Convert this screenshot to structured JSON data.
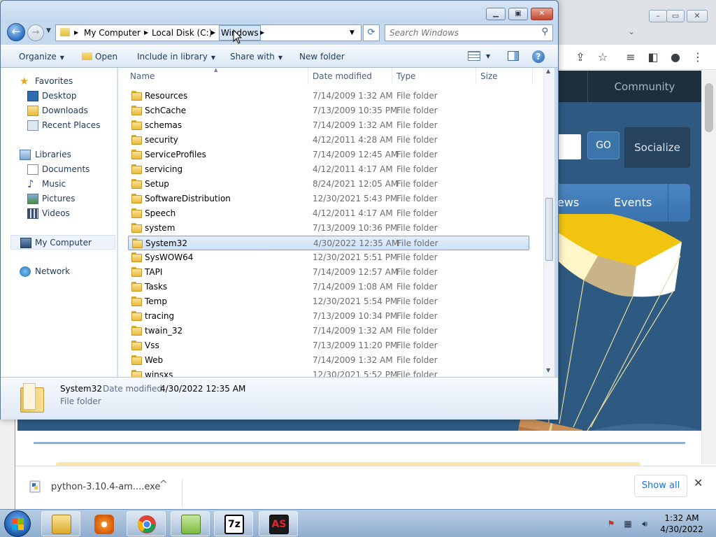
{
  "browser": {
    "site_nav": {
      "community": "Community"
    },
    "hero": {
      "go_button": "GO",
      "socialize": "Socialize",
      "nav_news": "ews",
      "nav_events": "Events"
    },
    "downloads_shelf": {
      "file_name": "python-3.10.4-am....exe",
      "show_all": "Show all"
    }
  },
  "explorer": {
    "address": {
      "crumbs": [
        "My Computer",
        "Local Disk (C:)",
        "Windows"
      ]
    },
    "search": {
      "placeholder": "Search Windows"
    },
    "commands": {
      "organize": "Organize",
      "open": "Open",
      "include_in_library": "Include in library",
      "share_with": "Share with",
      "new_folder": "New folder"
    },
    "nav_pane": {
      "favorites": "Favorites",
      "desktop": "Desktop",
      "downloads": "Downloads",
      "recent_places": "Recent Places",
      "libraries": "Libraries",
      "documents": "Documents",
      "music": "Music",
      "pictures": "Pictures",
      "videos": "Videos",
      "my_computer": "My Computer",
      "network": "Network"
    },
    "columns": {
      "name": "Name",
      "date_modified": "Date modified",
      "type": "Type",
      "size": "Size"
    },
    "files": [
      {
        "name": "Resources",
        "date": "7/14/2009 1:32 AM",
        "type": "File folder"
      },
      {
        "name": "SchCache",
        "date": "7/13/2009 10:35 PM",
        "type": "File folder"
      },
      {
        "name": "schemas",
        "date": "7/14/2009 1:32 AM",
        "type": "File folder"
      },
      {
        "name": "security",
        "date": "4/12/2011 4:28 AM",
        "type": "File folder"
      },
      {
        "name": "ServiceProfiles",
        "date": "7/14/2009 12:45 AM",
        "type": "File folder"
      },
      {
        "name": "servicing",
        "date": "4/12/2011 4:17 AM",
        "type": "File folder"
      },
      {
        "name": "Setup",
        "date": "8/24/2021 12:05 AM",
        "type": "File folder"
      },
      {
        "name": "SoftwareDistribution",
        "date": "12/30/2021 5:43 PM",
        "type": "File folder"
      },
      {
        "name": "Speech",
        "date": "4/12/2011 4:17 AM",
        "type": "File folder"
      },
      {
        "name": "system",
        "date": "7/13/2009 10:36 PM",
        "type": "File folder"
      },
      {
        "name": "System32",
        "date": "4/30/2022 12:35 AM",
        "type": "File folder"
      },
      {
        "name": "SysWOW64",
        "date": "12/30/2021 5:51 PM",
        "type": "File folder"
      },
      {
        "name": "TAPI",
        "date": "7/14/2009 12:57 AM",
        "type": "File folder"
      },
      {
        "name": "Tasks",
        "date": "7/14/2009 1:08 AM",
        "type": "File folder"
      },
      {
        "name": "Temp",
        "date": "12/30/2021 5:54 PM",
        "type": "File folder"
      },
      {
        "name": "tracing",
        "date": "7/13/2009 10:34 PM",
        "type": "File folder"
      },
      {
        "name": "twain_32",
        "date": "7/14/2009 1:32 AM",
        "type": "File folder"
      },
      {
        "name": "Vss",
        "date": "7/13/2009 11:20 PM",
        "type": "File folder"
      },
      {
        "name": "Web",
        "date": "7/14/2009 1:32 AM",
        "type": "File folder"
      },
      {
        "name": "winsxs",
        "date": "12/30/2021 5:52 PM",
        "type": "File folder"
      }
    ],
    "selected_file": "System32",
    "details": {
      "name": "System32",
      "date_label": "Date modified:",
      "date_value": "4/30/2022 12:35 AM",
      "type": "File folder"
    }
  },
  "taskbar": {
    "apps": [
      "windows-explorer",
      "media-player",
      "chrome",
      "notepad-plus-plus",
      "7-zip",
      "autosplit"
    ],
    "app_labels": {
      "seven_zip": "7z",
      "autosplit": "AS"
    },
    "clock": {
      "time": "1:32 AM",
      "date": "4/30/2022"
    }
  },
  "colors": {
    "selection": "#cfe1f6",
    "selection_border": "#7da2ce",
    "hero_blue": "#2e5a82",
    "nav_dark": "#1f2e3c"
  }
}
